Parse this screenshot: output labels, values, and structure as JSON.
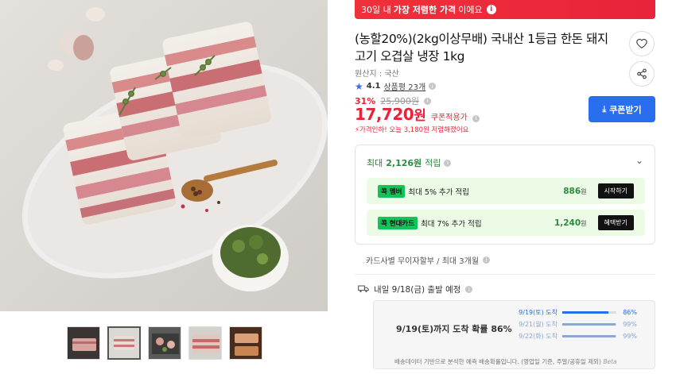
{
  "banner": {
    "prefix": "30일 내 ",
    "bold": "가장 저렴한 가격",
    "suffix": "이에요",
    "info_icon": "info-icon"
  },
  "product": {
    "title": "(농할20%)(2kg이상무배) 국내산 1등급 한돈 돼지고기 오겹살 냉장 1kg",
    "origin": "원산지 : 국산",
    "rating": "4.1",
    "reviews": "상품평 23개"
  },
  "pricing": {
    "discount_pct": "31%",
    "original_price": "25,900원",
    "price": "17,720",
    "price_unit": "원",
    "coupon_label": "쿠폰적용가",
    "drop_note": "가격인하! 오늘 3,180원 저렴해졌어요",
    "coupon_button": "쿠폰받기"
  },
  "rewards": {
    "head_prefix": "최대 ",
    "head_amount": "2,126원",
    "head_suffix": " 적립",
    "rows": [
      {
        "badge": "콕 멤버",
        "text": "최대 5% 추가 적립",
        "amount": "886",
        "unit": "원",
        "action": "시작하기"
      },
      {
        "badge": "콕 현대카드",
        "text": "최대 7% 추가 적립",
        "amount": "1,240",
        "unit": "원",
        "action": "혜택받기"
      }
    ]
  },
  "installment": "카드사별 무이자할부 / 최대 3개월",
  "delivery": {
    "text": "내일 9/18(금) 출발 예정"
  },
  "probability": {
    "title": "9/19(토)까지 도착 확률 86%",
    "lines": [
      {
        "label": "9/19(토) 도착",
        "pct": 0.86,
        "value": "86%",
        "color": "#2a6ef0"
      },
      {
        "label": "9/21(월) 도착",
        "pct": 0.99,
        "value": "99%",
        "color": "#8aa7d8"
      },
      {
        "label": "9/22(화) 도착",
        "pct": 0.99,
        "value": "99%",
        "color": "#8aa7d8"
      }
    ],
    "note": "배송데이터 기반으로 분석한 예측 배송확률입니다. (영업일 기준, 주말/공휴일 제외)",
    "beta": "Beta"
  },
  "colors": {
    "accent_red": "#e9233a",
    "accent_blue": "#2a6ef0",
    "reward_green": "#2b8a3e"
  }
}
